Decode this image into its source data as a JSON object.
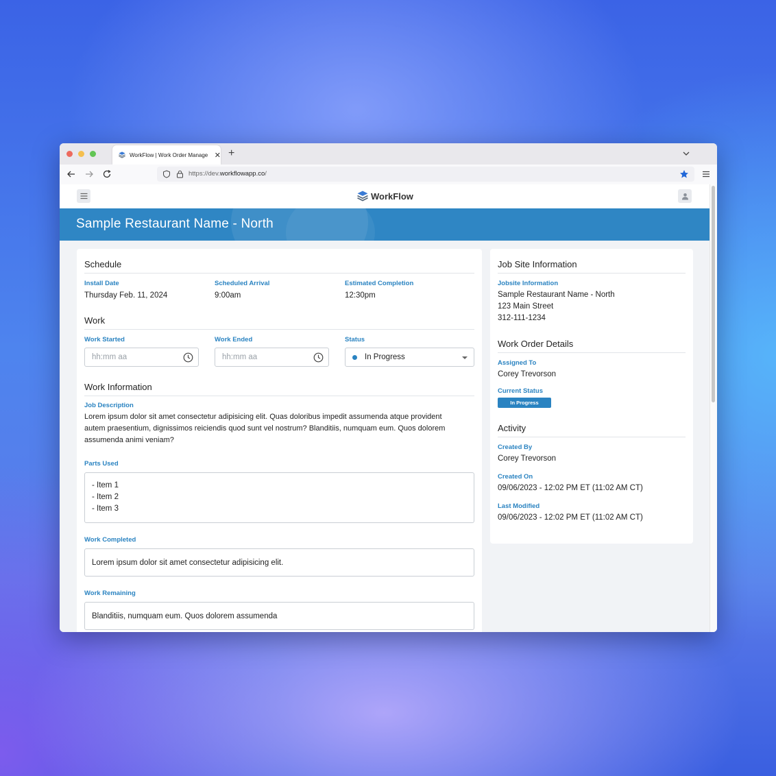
{
  "browser": {
    "tab_title": "WorkFlow | Work Order Manage",
    "tab_close": "✕",
    "new_tab": "+",
    "url_prefix": "https://dev.",
    "url_domain": "workflowapp.co",
    "url_suffix": "/"
  },
  "app": {
    "brand": "WorkFlow",
    "page_title": "Sample Restaurant Name - North"
  },
  "schedule": {
    "title": "Schedule",
    "install_date_label": "Install Date",
    "install_date": "Thursday Feb. 11, 2024",
    "arrival_label": "Scheduled Arrival",
    "arrival": "9:00am",
    "completion_label": "Estimated Completion",
    "completion": "12:30pm"
  },
  "work": {
    "title": "Work",
    "started_label": "Work Started",
    "started_placeholder": "hh:mm aa",
    "ended_label": "Work Ended",
    "ended_placeholder": "hh:mm aa",
    "status_label": "Status",
    "status_value": "In Progress",
    "status_color": "#2a83c1"
  },
  "work_info": {
    "title": "Work Information",
    "job_desc_label": "Job Description",
    "job_desc_lines": [
      "Lorem ipsum dolor sit amet consectetur adipisicing elit. Quas doloribus impedit assumenda atque provident",
      "autem praesentium, dignissimos reiciendis quod sunt vel nostrum? Blanditiis, numquam eum. Quos dolorem",
      "assumenda animi veniam?"
    ],
    "parts_label": "Parts Used",
    "parts": [
      "- Item 1",
      "- Item 2",
      "- Item 3"
    ],
    "completed_label": "Work Completed",
    "completed": "Lorem ipsum dolor sit amet consectetur adipisicing elit.",
    "remaining_label": "Work Remaining",
    "remaining": "Blanditiis, numquam eum. Quos dolorem assumenda"
  },
  "job_site": {
    "title": "Job Site Information",
    "jobsite_label": "Jobsite Information",
    "name": "Sample Restaurant Name - North",
    "address": "123 Main Street",
    "phone": "312-111-1234"
  },
  "work_order": {
    "title": "Work Order Details",
    "assigned_label": "Assigned To",
    "assigned": "Corey Trevorson",
    "status_label": "Current Status",
    "status_badge": "In Progress"
  },
  "activity": {
    "title": "Activity",
    "created_by_label": "Created By",
    "created_by": "Corey Trevorson",
    "created_on_label": "Created On",
    "created_on": "09/06/2023 - 12:02 PM ET (11:02 AM CT)",
    "modified_label": "Last Modified",
    "modified": "09/06/2023 - 12:02 PM ET (11:02 AM CT)"
  },
  "colors": {
    "accent": "#2a83c1",
    "banner": "#2f86c4",
    "page_bg": "#f1f3f6"
  }
}
